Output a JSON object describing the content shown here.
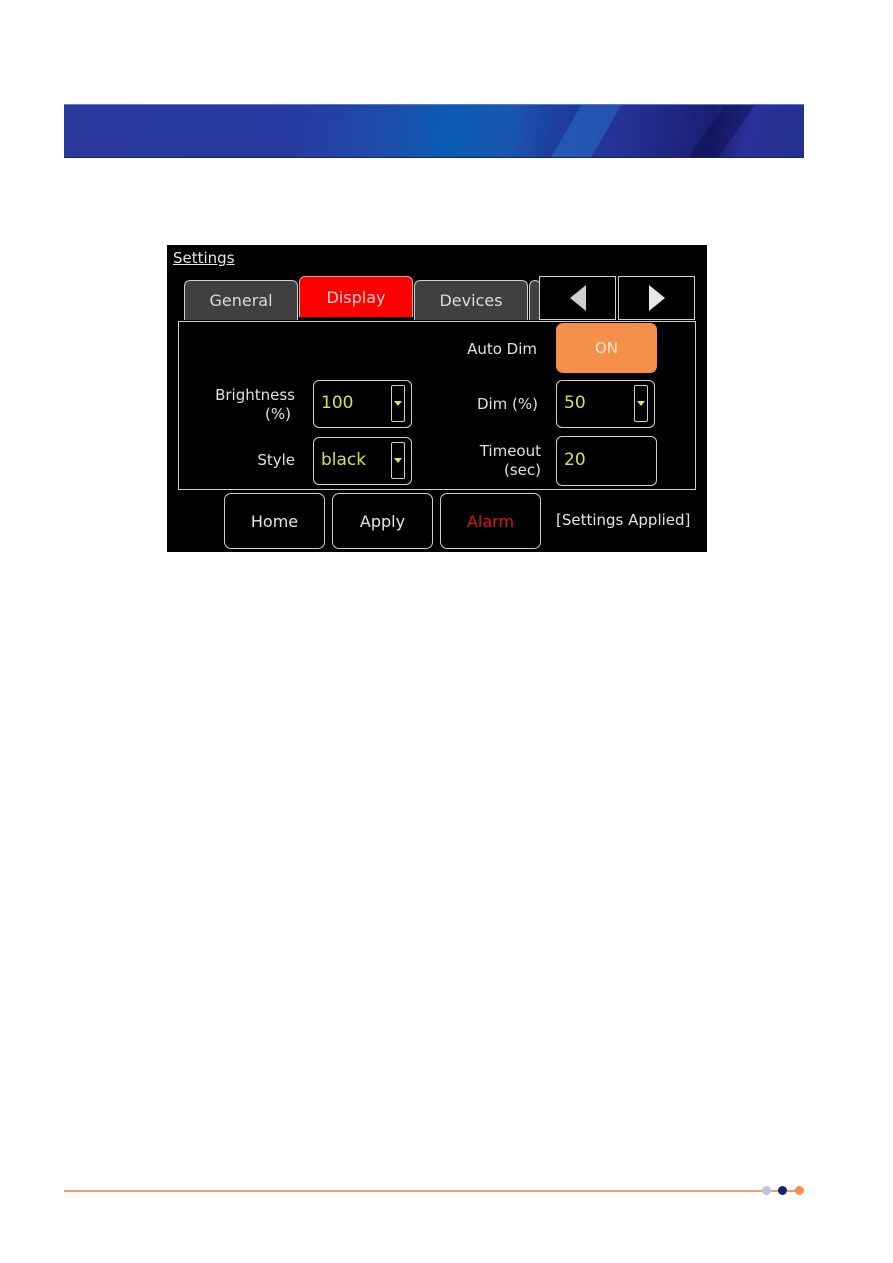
{
  "screen": {
    "title": "Settings",
    "tabs": [
      {
        "label": "General",
        "active": false
      },
      {
        "label": "Display",
        "active": true
      },
      {
        "label": "Devices",
        "active": false
      }
    ],
    "nav": {
      "prev_icon": "triangle-left-icon",
      "next_icon": "triangle-right-icon"
    },
    "fields": {
      "auto_dim": {
        "label": "Auto Dim",
        "value": "ON"
      },
      "brightness": {
        "label_line1": "Brightness",
        "label_line2": "(%)",
        "value": "100"
      },
      "dim": {
        "label": "Dim (%)",
        "value": "50"
      },
      "style": {
        "label": "Style",
        "value": "black"
      },
      "timeout": {
        "label_line1": "Timeout",
        "label_line2": "(sec)",
        "value": "20"
      }
    },
    "buttons": {
      "home": "Home",
      "apply": "Apply",
      "alarm": "Alarm"
    },
    "status": "[Settings Applied]"
  },
  "colors": {
    "active_tab": "#ff0000",
    "toggle_on": "#f5904a",
    "value_text": "#d8e05a",
    "alarm_text": "#e01414",
    "footer_accent": "#e8a070"
  }
}
